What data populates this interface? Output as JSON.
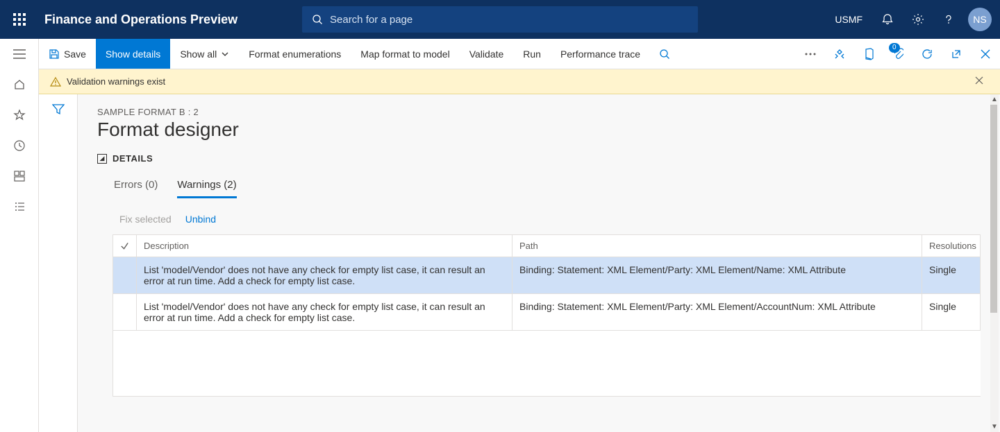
{
  "header": {
    "app_title": "Finance and Operations Preview",
    "search_placeholder": "Search for a page",
    "company": "USMF",
    "avatar_initials": "NS"
  },
  "actions": {
    "save": "Save",
    "show_details": "Show details",
    "show_all": "Show all",
    "format_enum": "Format enumerations",
    "map_format": "Map format to model",
    "validate": "Validate",
    "run": "Run",
    "performance": "Performance trace",
    "attach_badge": "0"
  },
  "banner": {
    "message": "Validation warnings exist"
  },
  "page": {
    "breadcrumb": "SAMPLE FORMAT B : 2",
    "title": "Format designer",
    "details_label": "DETAILS"
  },
  "tabs": {
    "errors": "Errors (0)",
    "warnings": "Warnings (2)"
  },
  "grid_actions": {
    "fix": "Fix selected",
    "unbind": "Unbind"
  },
  "grid": {
    "headers": {
      "description": "Description",
      "path": "Path",
      "resolutions": "Resolutions"
    },
    "rows": [
      {
        "description": "List 'model/Vendor' does not have any check for empty list case, it can result an error at run time. Add a check for empty list case.",
        "path": "Binding: Statement: XML Element/Party: XML Element/Name: XML Attribute",
        "resolutions": "Single",
        "selected": true
      },
      {
        "description": "List 'model/Vendor' does not have any check for empty list case, it can result an error at run time. Add a check for empty list case.",
        "path": "Binding: Statement: XML Element/Party: XML Element/AccountNum: XML Attribute",
        "resolutions": "Single",
        "selected": false
      }
    ]
  }
}
